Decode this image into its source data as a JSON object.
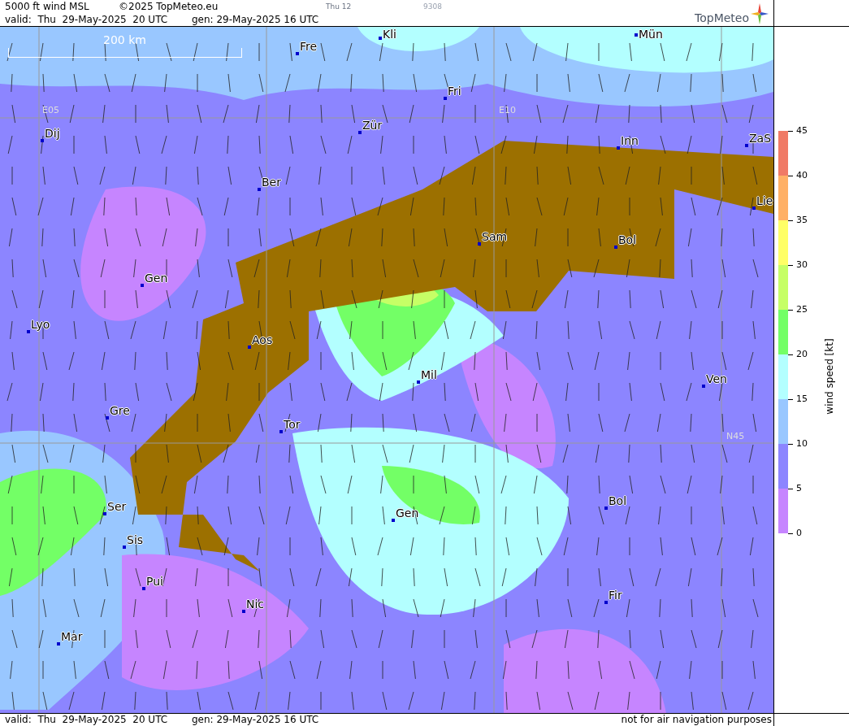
{
  "header": {
    "product": "5000 ft wind MSL",
    "copyright": "©2025 TopMeteo.eu",
    "run": "Thu 12",
    "code": "9308",
    "valid": "valid:  Thu  29-May-2025  20 UTC",
    "generated": "gen: 29-May-2025 16 UTC",
    "logo": "TopMeteo"
  },
  "map": {
    "scale": "200 km",
    "grid_labels": [
      "E05",
      "E10",
      "N45"
    ],
    "cities": [
      {
        "name": "Kli"
      },
      {
        "name": "Mün"
      },
      {
        "name": "Fre"
      },
      {
        "name": "Fri"
      },
      {
        "name": "Dij"
      },
      {
        "name": "Zür"
      },
      {
        "name": "Inn"
      },
      {
        "name": "ZaS"
      },
      {
        "name": "Ber"
      },
      {
        "name": "Lie"
      },
      {
        "name": "Sam"
      },
      {
        "name": "Bol"
      },
      {
        "name": "Gen"
      },
      {
        "name": "Lyo"
      },
      {
        "name": "Aos"
      },
      {
        "name": "Mil"
      },
      {
        "name": "Ven"
      },
      {
        "name": "Gre"
      },
      {
        "name": "Tor"
      },
      {
        "name": "Ser"
      },
      {
        "name": "Gen"
      },
      {
        "name": "Bol"
      },
      {
        "name": "Sis"
      },
      {
        "name": "Pui"
      },
      {
        "name": "Fir"
      },
      {
        "name": "Nic"
      },
      {
        "name": "Mar"
      }
    ]
  },
  "legend": {
    "title": "wind speed [kt]",
    "ticks": [
      "45",
      "40",
      "35",
      "30",
      "25",
      "20",
      "15",
      "10",
      "5",
      "0"
    ],
    "bands": [
      {
        "color": "#f07a66"
      },
      {
        "color": "#ffb066"
      },
      {
        "color": "#ffff66"
      },
      {
        "color": "#c6ff66"
      },
      {
        "color": "#73ff66"
      },
      {
        "color": "#b3ffff"
      },
      {
        "color": "#99c7ff"
      },
      {
        "color": "#8c85ff"
      },
      {
        "color": "#c685ff"
      }
    ]
  },
  "footer": {
    "valid": "valid:  Thu  29-May-2025  20 UTC",
    "generated": "gen: 29-May-2025 16 UTC",
    "disclaimer": "not for air navigation purposes"
  }
}
